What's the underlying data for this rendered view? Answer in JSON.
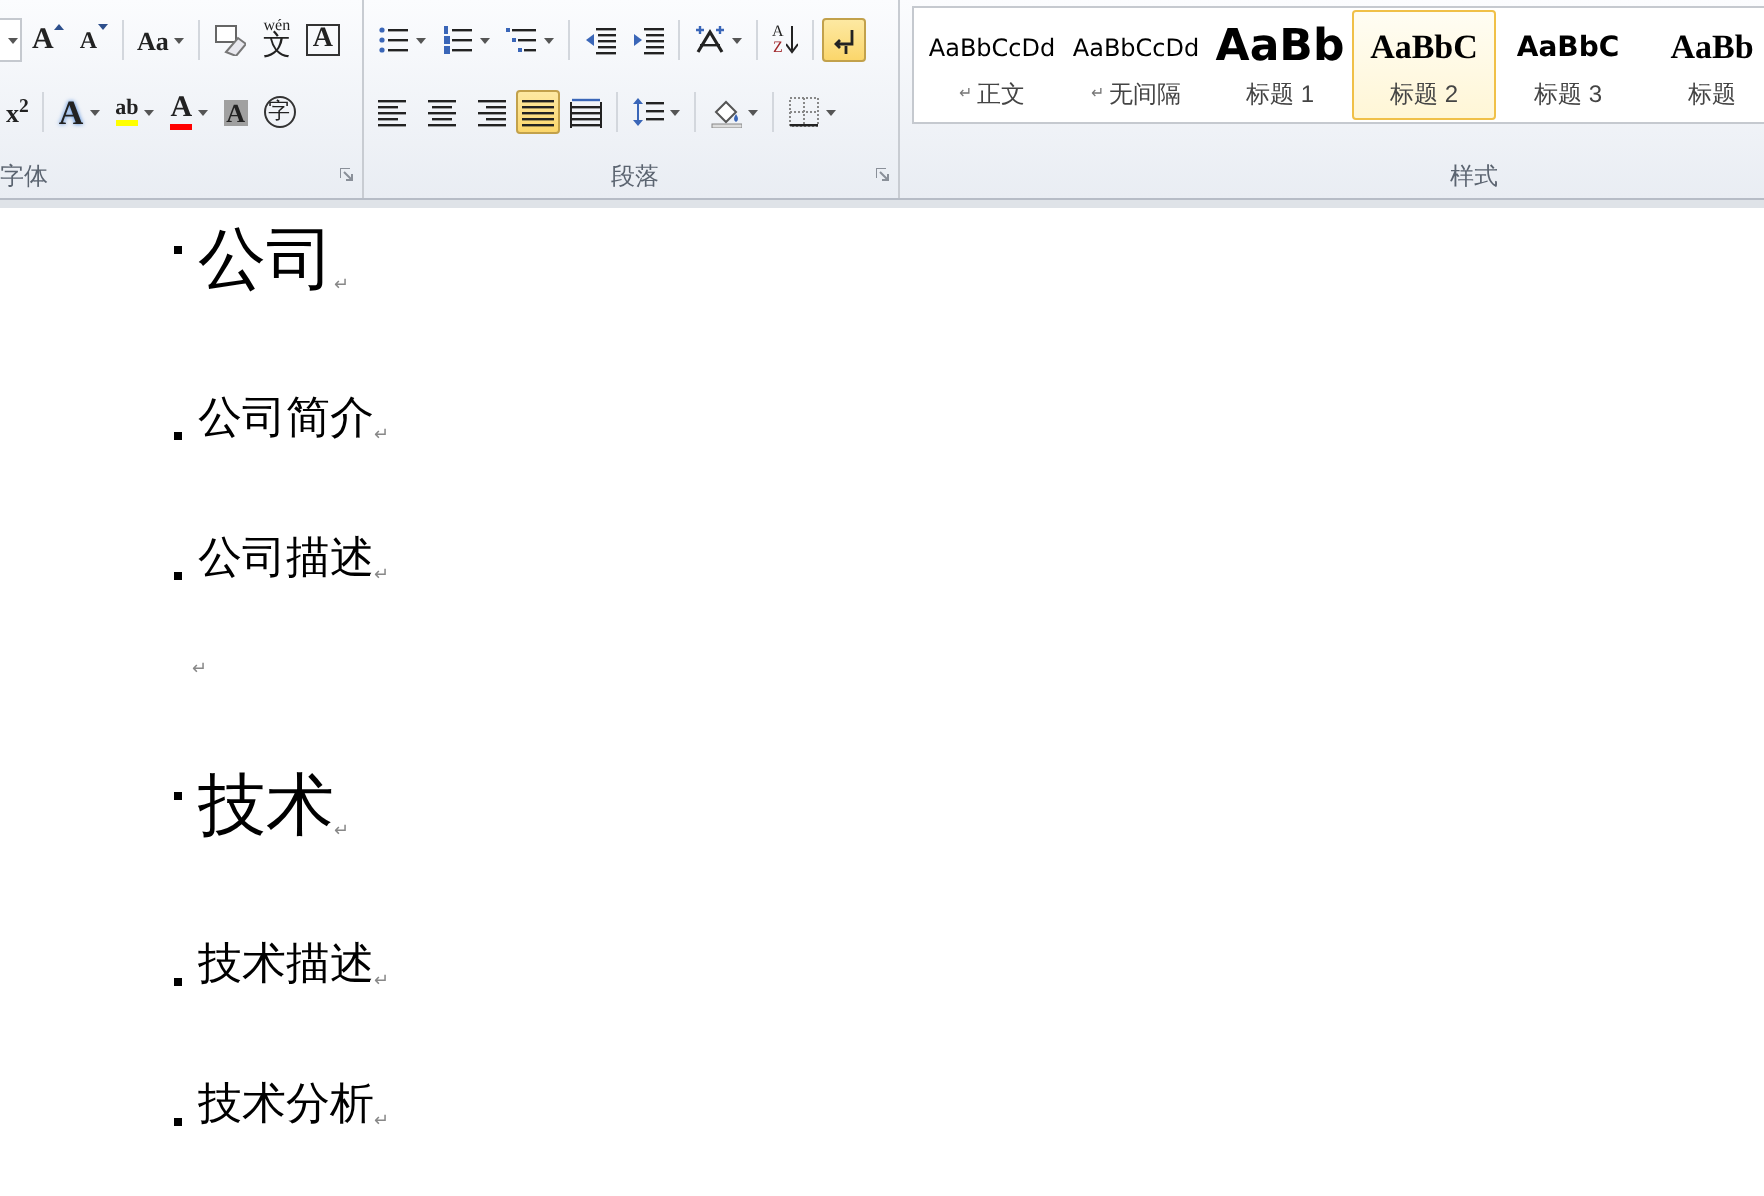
{
  "ribbon": {
    "font_group": {
      "label": "字体",
      "row1": [
        {
          "kind": "size-edge",
          "dropdown": true
        },
        {
          "kind": "grow-font",
          "glyph": "A"
        },
        {
          "kind": "shrink-font",
          "glyph": "A"
        },
        {
          "kind": "change-case",
          "glyph": "Aa",
          "dropdown": true
        },
        {
          "kind": "clear-format"
        },
        {
          "kind": "phonetic",
          "ruby": "wén",
          "glyph": "文"
        },
        {
          "kind": "char-border",
          "glyph": "A"
        }
      ],
      "row2": [
        {
          "kind": "superscript",
          "glyph": "x$^{2}$"
        },
        {
          "kind": "text-effect",
          "glyph": "A",
          "dropdown": true
        },
        {
          "kind": "highlight",
          "glyph": "ab",
          "dropdown": true
        },
        {
          "kind": "font-color",
          "glyph": "A",
          "dropdown": true
        },
        {
          "kind": "char-shading",
          "glyph": "A"
        },
        {
          "kind": "enclose",
          "glyph": "字"
        }
      ]
    },
    "paragraph_group": {
      "label": "段落",
      "row1": [
        {
          "kind": "bullets",
          "dropdown": true
        },
        {
          "kind": "numbering",
          "dropdown": true
        },
        {
          "kind": "multilevel",
          "dropdown": true
        },
        {
          "kind": "decrease-indent"
        },
        {
          "kind": "increase-indent"
        },
        {
          "kind": "asian-layout",
          "dropdown": true
        },
        {
          "kind": "sort",
          "glyph": "A",
          "glyph2": "Z"
        },
        {
          "kind": "show-marks",
          "on": true
        }
      ],
      "alignment": [
        {
          "kind": "align-left",
          "selected": false
        },
        {
          "kind": "align-center",
          "selected": false
        },
        {
          "kind": "align-right",
          "selected": false
        },
        {
          "kind": "justify",
          "selected": true
        },
        {
          "kind": "distribute",
          "selected": false
        }
      ],
      "row2": [
        {
          "kind": "line-spacing",
          "dropdown": true
        },
        {
          "kind": "shading",
          "dropdown": true
        },
        {
          "kind": "borders",
          "dropdown": true
        }
      ]
    },
    "styles_group": {
      "label": "样式",
      "styles": [
        {
          "kind": "normal",
          "preview": "AaBbCcDd",
          "prefix": "↵",
          "label": "正文",
          "selected": false
        },
        {
          "kind": "normal",
          "preview": "AaBbCcDd",
          "prefix": "↵",
          "label": "无间隔",
          "selected": false
        },
        {
          "kind": "heading1",
          "preview": "AaBb",
          "label": "标题 1",
          "selected": false
        },
        {
          "kind": "heading2",
          "preview": "AaBbC",
          "label": "标题 2",
          "selected": true
        },
        {
          "kind": "heading3",
          "preview": "AaBbC",
          "label": "标题 3",
          "selected": false
        },
        {
          "kind": "title",
          "preview": "AaBb",
          "label": "标题",
          "selected": false
        }
      ]
    }
  },
  "document": {
    "paragraphs": [
      {
        "kind": "heading1",
        "text": "公司",
        "mark": "↵"
      },
      {
        "kind": "heading2",
        "text": "公司简介",
        "mark": "↵"
      },
      {
        "kind": "heading2",
        "text": "公司描述",
        "mark": "↵"
      },
      {
        "kind": "empty",
        "mark": "↵"
      },
      {
        "kind": "heading1",
        "text": "技术",
        "mark": "↵"
      },
      {
        "kind": "heading2",
        "text": "技术描述",
        "mark": "↵"
      },
      {
        "kind": "heading2",
        "text": "技术分析",
        "mark": "↵"
      }
    ]
  }
}
